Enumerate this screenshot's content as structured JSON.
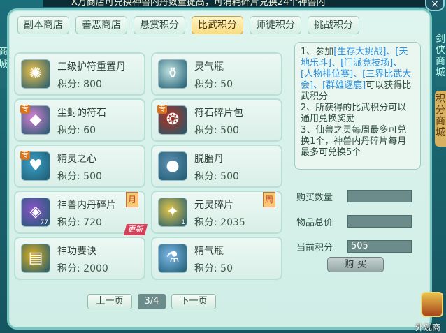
{
  "top_notice": "X万商店可兑换神兽内丹数量提高，可消耗碎片兑换24个神兽内",
  "close_icon": "×",
  "side": {
    "left_label": "商城",
    "right_tab1": "剑侠商城",
    "right_tab2": "积分商城"
  },
  "tabs": [
    {
      "label": "副本商店"
    },
    {
      "label": "善恶商店"
    },
    {
      "label": "悬赏积分"
    },
    {
      "label": "比武积分",
      "active": true
    },
    {
      "label": "师徒积分"
    },
    {
      "label": "挑战积分"
    }
  ],
  "items": [
    {
      "name": "三级护符重置丹",
      "price": "积分: 800",
      "icon": "amulet-pill-icon"
    },
    {
      "name": "灵气瓶",
      "price": "积分: 50",
      "icon": "spirit-bottle-icon"
    },
    {
      "name": "尘封的符石",
      "price": "积分: 60",
      "icon": "rune-stone-icon",
      "badge": "专"
    },
    {
      "name": "符石碎片包",
      "price": "积分: 500",
      "icon": "rune-bag-icon",
      "badge": "专"
    },
    {
      "name": "精灵之心",
      "price": "积分: 500",
      "icon": "spirit-heart-icon",
      "badge": "专"
    },
    {
      "name": "脱胎丹",
      "price": "积分: 500",
      "icon": "rebirth-pill-icon"
    },
    {
      "name": "神兽内丹碎片",
      "price": "积分: 720",
      "icon": "beast-core-shard-icon",
      "count": "77",
      "limit": "月",
      "new": "更新"
    },
    {
      "name": "元灵碎片",
      "price": "积分: 2035",
      "icon": "spirit-shard-icon",
      "count": "1",
      "limit": "周"
    },
    {
      "name": "神功要诀",
      "price": "积分: 2000",
      "icon": "skill-book-icon"
    },
    {
      "name": "精气瓶",
      "price": "积分: 50",
      "icon": "essence-bottle-icon"
    }
  ],
  "description": {
    "p1_prefix": "1、参加",
    "p1_links": "[生存大挑战]、[天地乐斗]、[门派竞技场]、[人物排位赛]、[三界比武大会]、[群雄逐鹿]",
    "p1_suffix": "可以获得比武积分",
    "p2": "2、所获得的比武积分可以通用兑换奖励",
    "p3": "3、仙兽之灵每周最多可兑换1个，神兽内丹碎片每月最多可兑换5个"
  },
  "form": {
    "qty_label": "购买数量",
    "qty_value": "",
    "total_label": "物品总价",
    "total_value": "",
    "current_label": "当前积分",
    "current_value": "505",
    "buy_label": "购 买"
  },
  "pager": {
    "prev": "上一页",
    "page": "3/4",
    "next": "下一页"
  },
  "appearance_shop": "外观商"
}
